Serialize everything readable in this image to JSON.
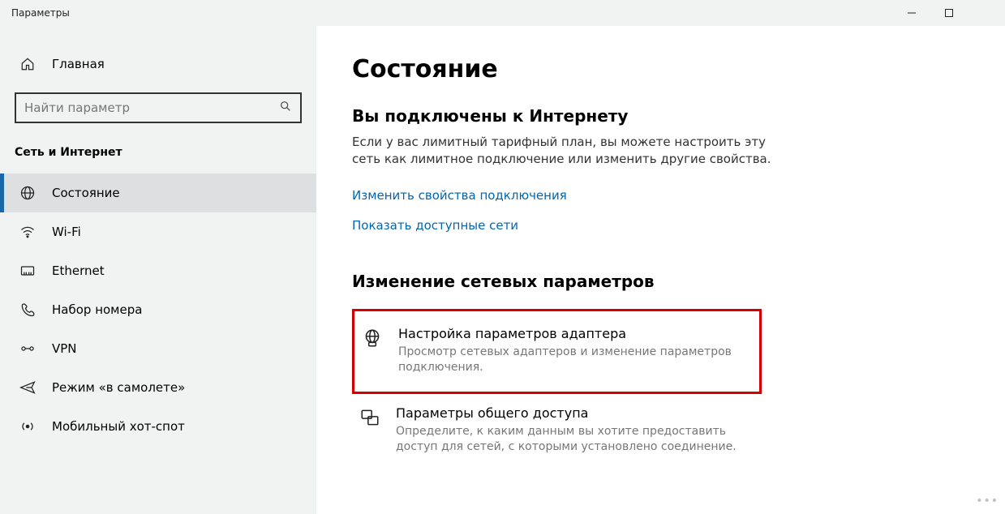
{
  "window": {
    "title": "Параметры"
  },
  "sidebar": {
    "home_label": "Главная",
    "search_placeholder": "Найти параметр",
    "section_label": "Сеть и Интернет",
    "items": [
      {
        "label": "Состояние",
        "icon": "globe-icon",
        "selected": true
      },
      {
        "label": "Wi-Fi",
        "icon": "wifi-icon",
        "selected": false
      },
      {
        "label": "Ethernet",
        "icon": "ethernet-icon",
        "selected": false
      },
      {
        "label": "Набор номера",
        "icon": "dialup-icon",
        "selected": false
      },
      {
        "label": "VPN",
        "icon": "vpn-icon",
        "selected": false
      },
      {
        "label": "Режим «в самолете»",
        "icon": "airplane-icon",
        "selected": false
      },
      {
        "label": "Мобильный хот-спот",
        "icon": "hotspot-icon",
        "selected": false
      }
    ]
  },
  "main": {
    "title": "Состояние",
    "connected_heading": "Вы подключены к Интернету",
    "connected_body": "Если у вас лимитный тарифный план, вы можете настроить эту сеть как лимитное подключение или изменить другие свойства.",
    "link_change_props": "Изменить свойства подключения",
    "link_show_networks": "Показать доступные сети",
    "change_section_title": "Изменение сетевых параметров",
    "options": [
      {
        "title": "Настройка параметров адаптера",
        "desc": "Просмотр сетевых адаптеров и изменение параметров подключения.",
        "icon": "adapter-icon",
        "highlight": true
      },
      {
        "title": "Параметры общего доступа",
        "desc": "Определите, к каким данным вы хотите предоставить доступ для сетей, с которыми установлено соединение.",
        "icon": "sharing-icon",
        "highlight": false
      }
    ]
  }
}
